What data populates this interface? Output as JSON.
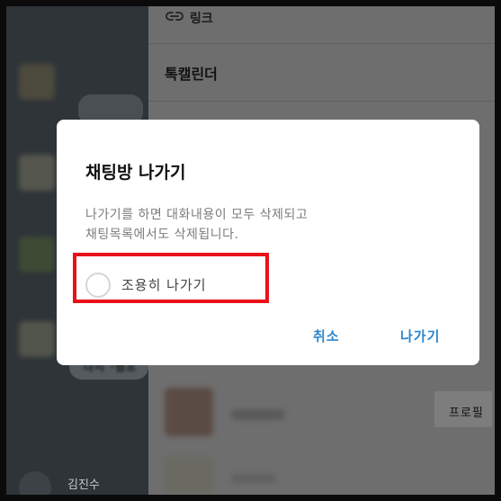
{
  "dialog": {
    "title": "채팅방 나가기",
    "body_line1": "나가기를 하면 대화내용이 모두 삭제되고",
    "body_line2": "채팅목록에서도 삭제됩니다.",
    "quiet_leave_label": "조용히 나가기",
    "quiet_leave_checked": false,
    "cancel_label": "취소",
    "leave_label": "나가기"
  },
  "drawer": {
    "link_label": "링크",
    "calendar_label": "톡캘린더",
    "profile_button_label": "프로필"
  },
  "chat": {
    "sender_name": "김진수"
  },
  "colors": {
    "accent": "#2f87cc",
    "highlight_border": "#e8111a"
  }
}
